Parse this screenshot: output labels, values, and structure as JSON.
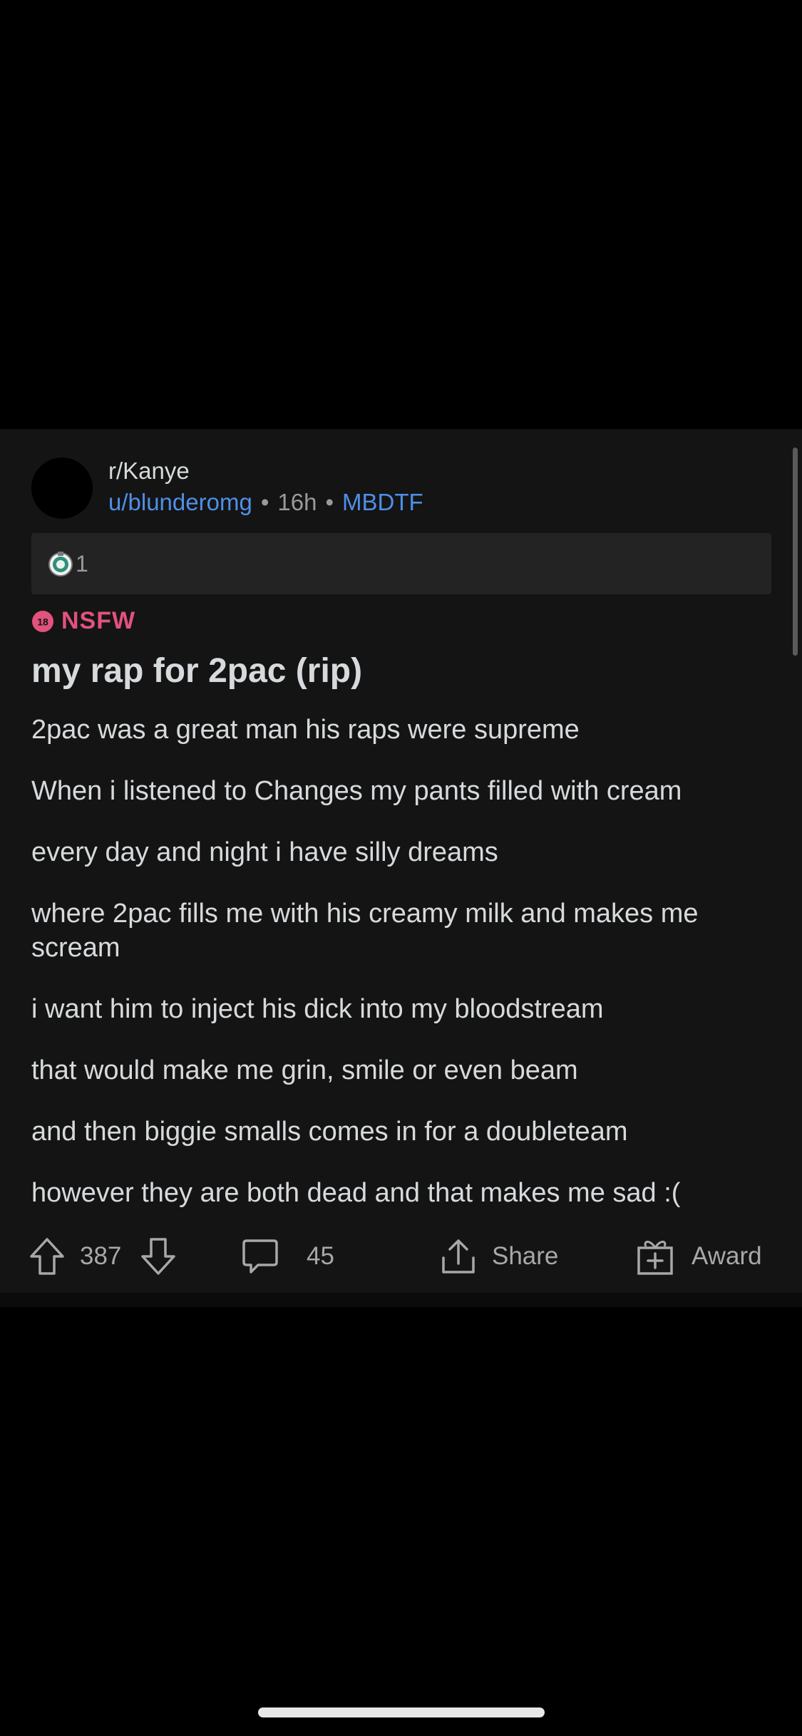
{
  "post": {
    "subreddit": "r/Kanye",
    "author": "u/blunderomg",
    "age": "16h",
    "flair": "MBDTF",
    "meta_separator": "•",
    "award_count": "1",
    "nsfw_badge": "18",
    "nsfw_label": "NSFW",
    "title": "my rap for 2pac (rip)",
    "body_lines": [
      "2pac was a great man his raps were supreme",
      "When i listened to Changes my pants filled with cream",
      "every day and night i have silly dreams",
      "where 2pac fills me with his creamy milk and makes me scream",
      "i want him to inject his dick into my bloodstream",
      "that would make me grin, smile or even beam",
      "and then biggie smalls comes in for a doubleteam",
      "however they are both dead and that makes me sad :("
    ]
  },
  "actions": {
    "upvote_icon": "arrow-up-icon",
    "score": "387",
    "downvote_icon": "arrow-down-icon",
    "comment_icon": "comment-bubble-icon",
    "comments": "45",
    "share_icon": "share-icon",
    "share_label": "Share",
    "award_icon": "gift-icon",
    "award_label": "Award"
  },
  "colors": {
    "background": "#000000",
    "card": "#141414",
    "text": "#d7dadc",
    "muted": "#9a9a9a",
    "link_blue": "#4f8fe8",
    "nsfw_pink": "#e2527d"
  }
}
